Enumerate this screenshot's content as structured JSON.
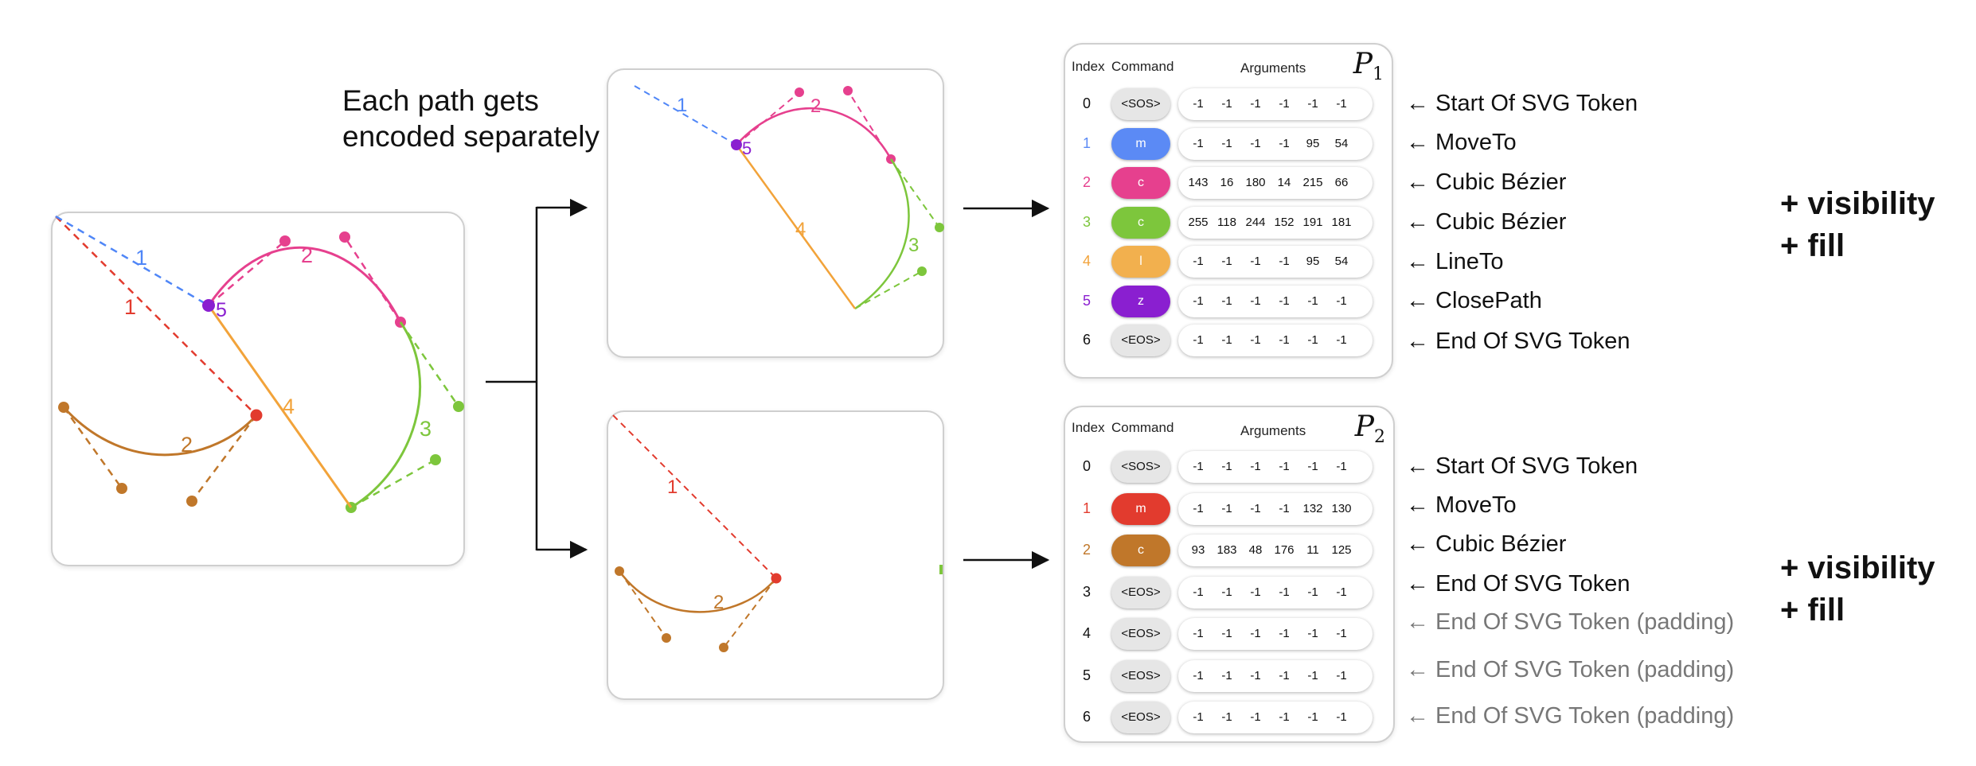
{
  "headline": [
    "Each path gets",
    "encoded separately"
  ],
  "colors": {
    "blue": "#4f86f7",
    "pink": "#e6408e",
    "green": "#7dc63c",
    "orange": "#f2a33a",
    "purple": "#8a1fd0",
    "red": "#e23b2e",
    "brown": "#c0772a"
  },
  "diagram": {
    "labels": {
      "one": "1",
      "two": "2",
      "three": "3",
      "four": "4",
      "five": "5"
    }
  },
  "tables": [
    {
      "title": "P",
      "title_sub": "1",
      "headers": {
        "index": "Index",
        "command": "Command",
        "arguments": "Arguments"
      },
      "rows": [
        {
          "index": "0",
          "command": "<SOS>",
          "pill_color": "grey",
          "args": [
            "-1",
            "-1",
            "-1",
            "-1",
            "-1",
            "-1"
          ],
          "desc": "← Start Of SVG Token",
          "padding": false
        },
        {
          "index": "1",
          "command": "m",
          "pill_color": "#5b8af5",
          "index_color": "#5b8af5",
          "args": [
            "-1",
            "-1",
            "-1",
            "-1",
            "95",
            "54"
          ],
          "desc": "← MoveTo",
          "padding": false
        },
        {
          "index": "2",
          "command": "c",
          "pill_color": "#e6408e",
          "index_color": "#e6408e",
          "args": [
            "143",
            "16",
            "180",
            "14",
            "215",
            "66"
          ],
          "desc": "← Cubic Bézier",
          "padding": false
        },
        {
          "index": "3",
          "command": "c",
          "pill_color": "#7dc63c",
          "index_color": "#7dc63c",
          "args": [
            "255",
            "118",
            "244",
            "152",
            "191",
            "181"
          ],
          "desc": "← Cubic Bézier",
          "padding": false
        },
        {
          "index": "4",
          "command": "l",
          "pill_color": "#f2b04e",
          "index_color": "#f2a33a",
          "args": [
            "-1",
            "-1",
            "-1",
            "-1",
            "95",
            "54"
          ],
          "desc": "← LineTo",
          "padding": false
        },
        {
          "index": "5",
          "command": "z",
          "pill_color": "#8a1fd0",
          "index_color": "#8a1fd0",
          "args": [
            "-1",
            "-1",
            "-1",
            "-1",
            "-1",
            "-1"
          ],
          "desc": "← ClosePath",
          "padding": false
        },
        {
          "index": "6",
          "command": "<EOS>",
          "pill_color": "grey",
          "args": [
            "-1",
            "-1",
            "-1",
            "-1",
            "-1",
            "-1"
          ],
          "desc": "← End Of SVG Token",
          "padding": false
        }
      ],
      "extra": [
        "+ visibility",
        "+ fill"
      ]
    },
    {
      "title": "P",
      "title_sub": "2",
      "headers": {
        "index": "Index",
        "command": "Command",
        "arguments": "Arguments"
      },
      "rows": [
        {
          "index": "0",
          "command": "<SOS>",
          "pill_color": "grey",
          "args": [
            "-1",
            "-1",
            "-1",
            "-1",
            "-1",
            "-1"
          ],
          "desc": "← Start Of SVG Token",
          "padding": false
        },
        {
          "index": "1",
          "command": "m",
          "pill_color": "#e23b2e",
          "index_color": "#e23b2e",
          "args": [
            "-1",
            "-1",
            "-1",
            "-1",
            "132",
            "130"
          ],
          "desc": "← MoveTo",
          "padding": false
        },
        {
          "index": "2",
          "command": "c",
          "pill_color": "#c0772a",
          "index_color": "#c0772a",
          "args": [
            "93",
            "183",
            "48",
            "176",
            "11",
            "125"
          ],
          "desc": "← Cubic Bézier",
          "padding": false
        },
        {
          "index": "3",
          "command": "<EOS>",
          "pill_color": "grey",
          "args": [
            "-1",
            "-1",
            "-1",
            "-1",
            "-1",
            "-1"
          ],
          "desc": "← End Of SVG Token",
          "padding": false
        },
        {
          "index": "4",
          "command": "<EOS>",
          "pill_color": "grey",
          "args": [
            "-1",
            "-1",
            "-1",
            "-1",
            "-1",
            "-1"
          ],
          "desc": "← End Of SVG Token (padding)",
          "padding": true
        },
        {
          "index": "5",
          "command": "<EOS>",
          "pill_color": "grey",
          "args": [
            "-1",
            "-1",
            "-1",
            "-1",
            "-1",
            "-1"
          ],
          "desc": "← End Of SVG Token (padding)",
          "padding": true
        },
        {
          "index": "6",
          "command": "<EOS>",
          "pill_color": "grey",
          "args": [
            "-1",
            "-1",
            "-1",
            "-1",
            "-1",
            "-1"
          ],
          "desc": "← End Of SVG Token (padding)",
          "padding": true
        }
      ],
      "extra": [
        "+ visibility",
        "+ fill"
      ]
    }
  ]
}
